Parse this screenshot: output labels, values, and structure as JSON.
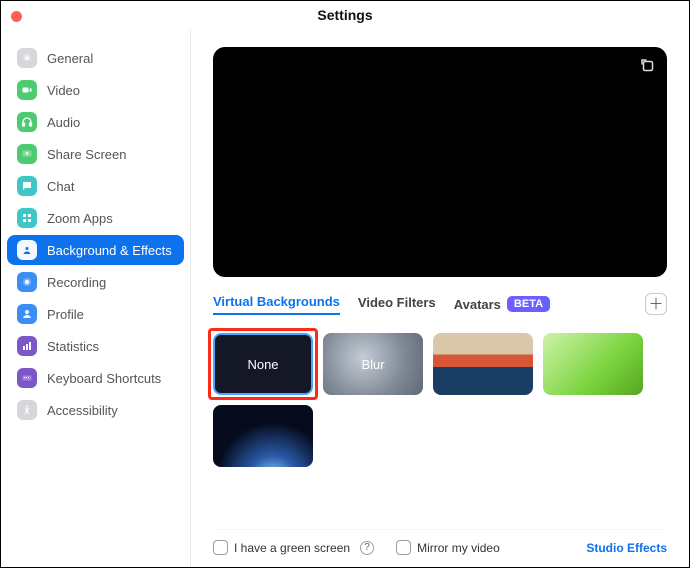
{
  "title": "Settings",
  "sidebar": {
    "items": [
      {
        "label": "General"
      },
      {
        "label": "Video"
      },
      {
        "label": "Audio"
      },
      {
        "label": "Share Screen"
      },
      {
        "label": "Chat"
      },
      {
        "label": "Zoom Apps"
      },
      {
        "label": "Background & Effects"
      },
      {
        "label": "Recording"
      },
      {
        "label": "Profile"
      },
      {
        "label": "Statistics"
      },
      {
        "label": "Keyboard Shortcuts"
      },
      {
        "label": "Accessibility"
      }
    ]
  },
  "tabs": {
    "virtual_backgrounds": "Virtual Backgrounds",
    "video_filters": "Video Filters",
    "avatars": "Avatars",
    "beta": "BETA"
  },
  "thumbs": {
    "none": "None",
    "blur": "Blur"
  },
  "footer": {
    "green_screen": "I have a green screen",
    "mirror": "Mirror my video",
    "studio": "Studio Effects",
    "help": "?"
  }
}
